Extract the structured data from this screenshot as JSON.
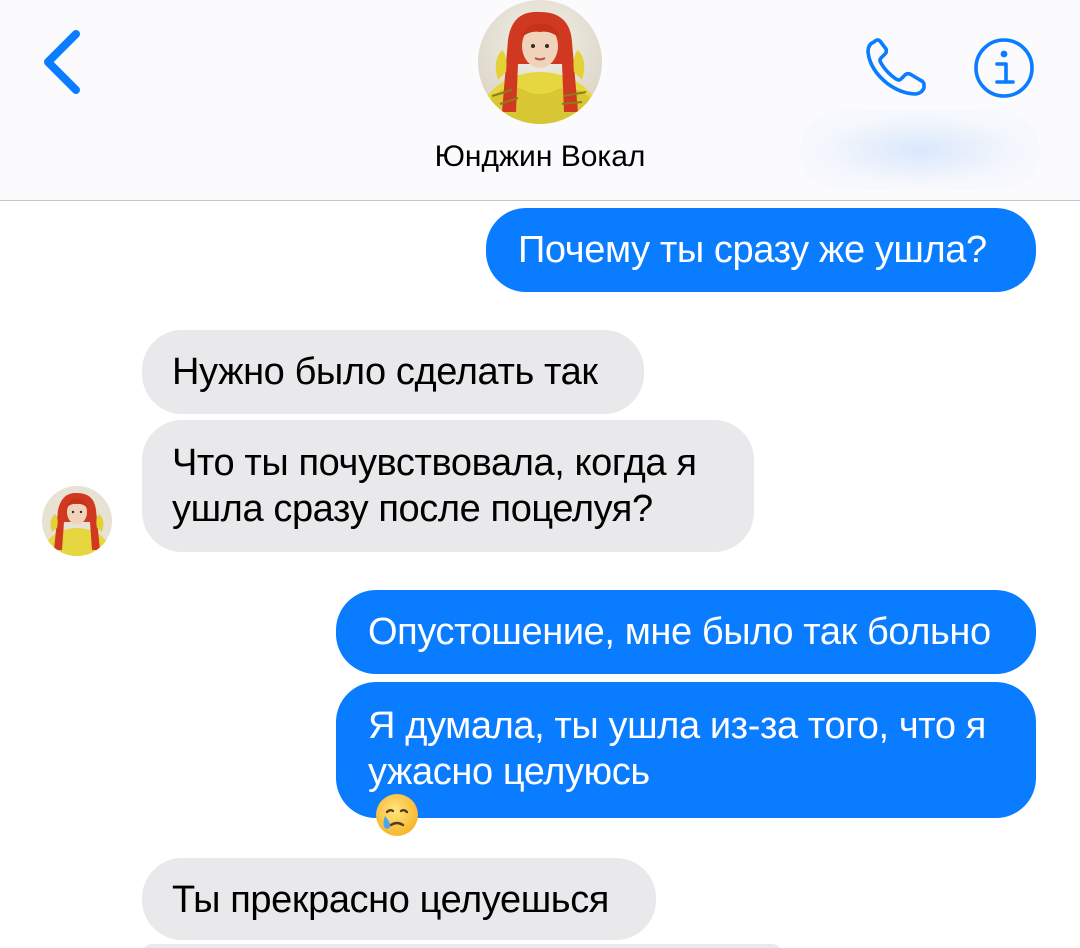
{
  "header": {
    "contact_name": "Юнджин Вокал",
    "back_icon": "chevron-left-icon",
    "call_icon": "phone-icon",
    "info_icon": "info-icon",
    "accent_color": "#0a7cff"
  },
  "messages": [
    {
      "direction": "outgoing",
      "lines": [
        "Почему ты сразу же ушла?"
      ]
    },
    {
      "direction": "incoming",
      "lines": [
        "Нужно было сделать так"
      ]
    },
    {
      "direction": "incoming",
      "lines": [
        "Что ты почувствовала, когда я",
        "ушла сразу после поцелуя?"
      ]
    },
    {
      "direction": "outgoing",
      "lines": [
        "Опустошение, мне было так больно"
      ]
    },
    {
      "direction": "outgoing",
      "lines": [
        "Я думала, ты ушла из-за того, что я",
        "ужасно целуюсь"
      ],
      "emoji": "crying-face-emoji"
    },
    {
      "direction": "incoming",
      "lines": [
        "Ты прекрасно целуешься"
      ]
    }
  ],
  "colors": {
    "outgoing_bubble": "#0a7cff",
    "incoming_bubble": "#e9e9eb",
    "outgoing_text": "#ffffff",
    "incoming_text": "#000000"
  }
}
